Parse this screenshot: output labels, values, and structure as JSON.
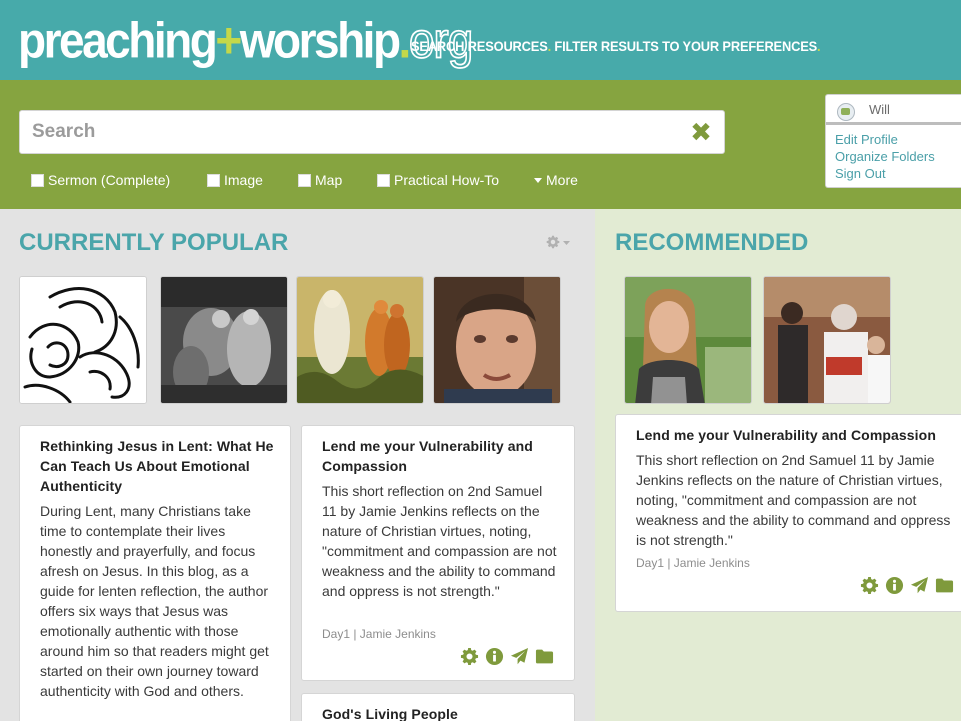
{
  "header": {
    "logo_part1": "preaching",
    "logo_plus": "+",
    "logo_part2": "worship",
    "logo_dot": ".",
    "logo_tld": "org",
    "tagline_1": "SEARCH RESOURCES",
    "tagline_2": "FILTER RESULTS TO YOUR PREFERENCES",
    "tagline_dot": "."
  },
  "search": {
    "placeholder": "Search",
    "clear_label": "✖",
    "filters": [
      {
        "label": "Sermon (Complete)"
      },
      {
        "label": "Image"
      },
      {
        "label": "Map"
      },
      {
        "label": "Practical How-To"
      }
    ],
    "more_label": "More"
  },
  "user": {
    "name": "Will",
    "links": [
      "Edit Profile",
      "Organize Folders",
      "Sign Out"
    ]
  },
  "popular": {
    "title": "CURRENTLY POPULAR",
    "cards": [
      {
        "title": "Rethinking Jesus in Lent: What He Can Teach Us About Emotional Authenticity",
        "body": "During Lent, many Christians take time to contemplate their lives honestly and prayerfully, and focus afresh on Jesus. In this blog, as a guide for lenten reflection, the author offers six ways that Jesus was emotionally authentic with those around him so that readers might get started on their own journey toward authenticity with God and others."
      },
      {
        "title": "Lend me your Vulnerability and Compassion",
        "body": "This short reflection on 2nd Samuel 11 by Jamie Jenkins reflects on the nature of Christian virtues, noting, \"commitment and compassion are not weakness and the ability to command and oppress is not strength.\"",
        "meta": "Day1 | Jamie Jenkins"
      },
      {
        "title": "God's Living People"
      }
    ]
  },
  "recommended": {
    "title": "RECOMMENDED",
    "cards": [
      {
        "title": "Lend me your Vulnerability and Compassion",
        "body": "This short reflection on 2nd Samuel 11 by Jamie Jenkins reflects on the nature of Christian virtues, noting, \"commitment and compassion are not weakness and the ability to command and oppress is not strength.\"",
        "meta": "Day1 | Jamie Jenkins"
      }
    ]
  },
  "colors": {
    "teal": "#47aaaa",
    "green": "#86a440",
    "accent_lime": "#c4d84a",
    "heading_teal": "#4aa5aa",
    "icon_green": "#7f9a3c"
  }
}
